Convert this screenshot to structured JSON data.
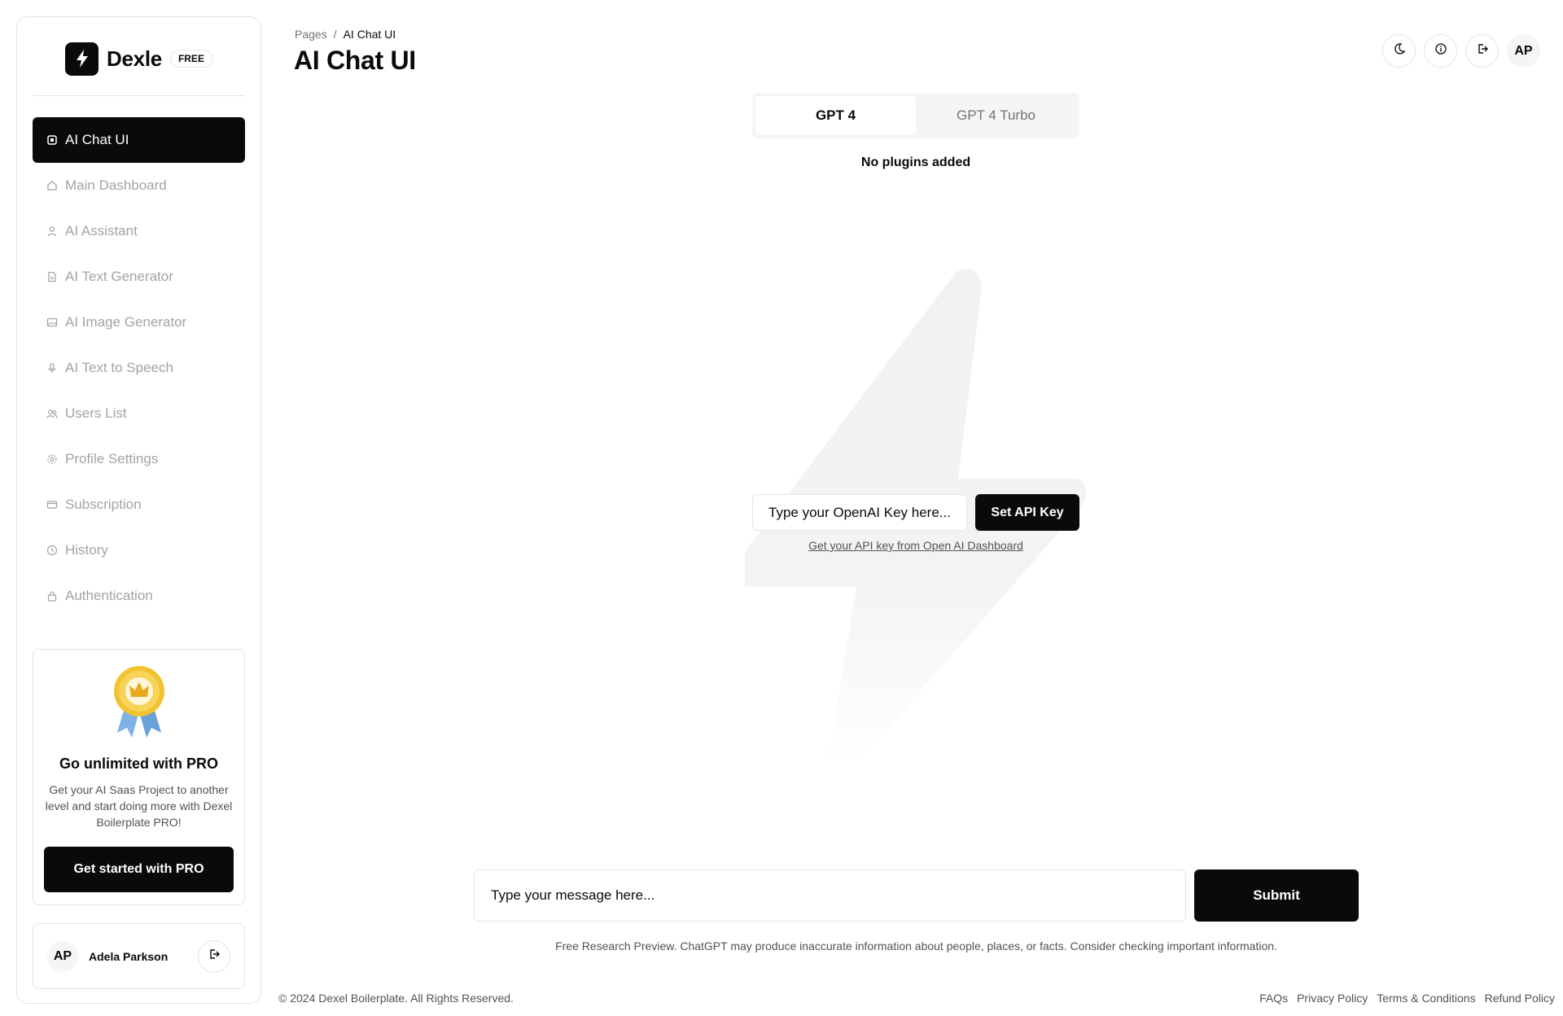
{
  "brand": {
    "name": "Dexle",
    "badge": "FREE"
  },
  "sidebar": {
    "items": [
      {
        "label": "AI Chat UI",
        "icon": "chip-icon",
        "active": true
      },
      {
        "label": "Main Dashboard",
        "icon": "home-icon"
      },
      {
        "label": "AI Assistant",
        "icon": "user-icon"
      },
      {
        "label": "AI Text Generator",
        "icon": "document-icon"
      },
      {
        "label": "AI Image Generator",
        "icon": "image-icon"
      },
      {
        "label": "AI Text to Speech",
        "icon": "microphone-icon"
      },
      {
        "label": "Users List",
        "icon": "users-icon"
      },
      {
        "label": "Profile Settings",
        "icon": "gear-icon"
      },
      {
        "label": "Subscription",
        "icon": "credit-card-icon"
      },
      {
        "label": "History",
        "icon": "clock-icon"
      },
      {
        "label": "Authentication",
        "icon": "lock-icon"
      }
    ]
  },
  "promo": {
    "title": "Go unlimited with PRO",
    "text": "Get your AI Saas Project to another level and start doing more with Dexel Boilerplate PRO!",
    "button": "Get started with PRO",
    "badge_icon": "award-ribbon-icon"
  },
  "user": {
    "initials": "AP",
    "name": "Adela Parkson"
  },
  "header": {
    "breadcrumb_root": "Pages",
    "breadcrumb_separator": "/",
    "breadcrumb_current": "AI Chat UI",
    "title": "AI Chat UI",
    "avatar_initials": "AP"
  },
  "model_tabs": [
    {
      "label": "GPT 4",
      "active": true
    },
    {
      "label": "GPT 4 Turbo",
      "active": false
    }
  ],
  "plugins_note": "No plugins added",
  "api": {
    "placeholder": "Type your OpenAI Key here...",
    "button": "Set API Key",
    "link": "Get your API key from Open AI Dashboard"
  },
  "message": {
    "placeholder": "Type your message here...",
    "submit": "Submit",
    "disclaimer": "Free Research Preview. ChatGPT may produce inaccurate information about people, places, or facts. Consider checking important information."
  },
  "footer": {
    "copyright": "© 2024 Dexel Boilerplate. All Rights Reserved.",
    "links": [
      "FAQs",
      "Privacy Policy",
      "Terms & Conditions",
      "Refund Policy"
    ]
  },
  "colors": {
    "primary": "#0a0a0a",
    "muted": "#a3a3a3",
    "border": "#e5e5e5",
    "badge_gold": "#f2c230",
    "ribbon_blue": "#7fb2e5"
  }
}
